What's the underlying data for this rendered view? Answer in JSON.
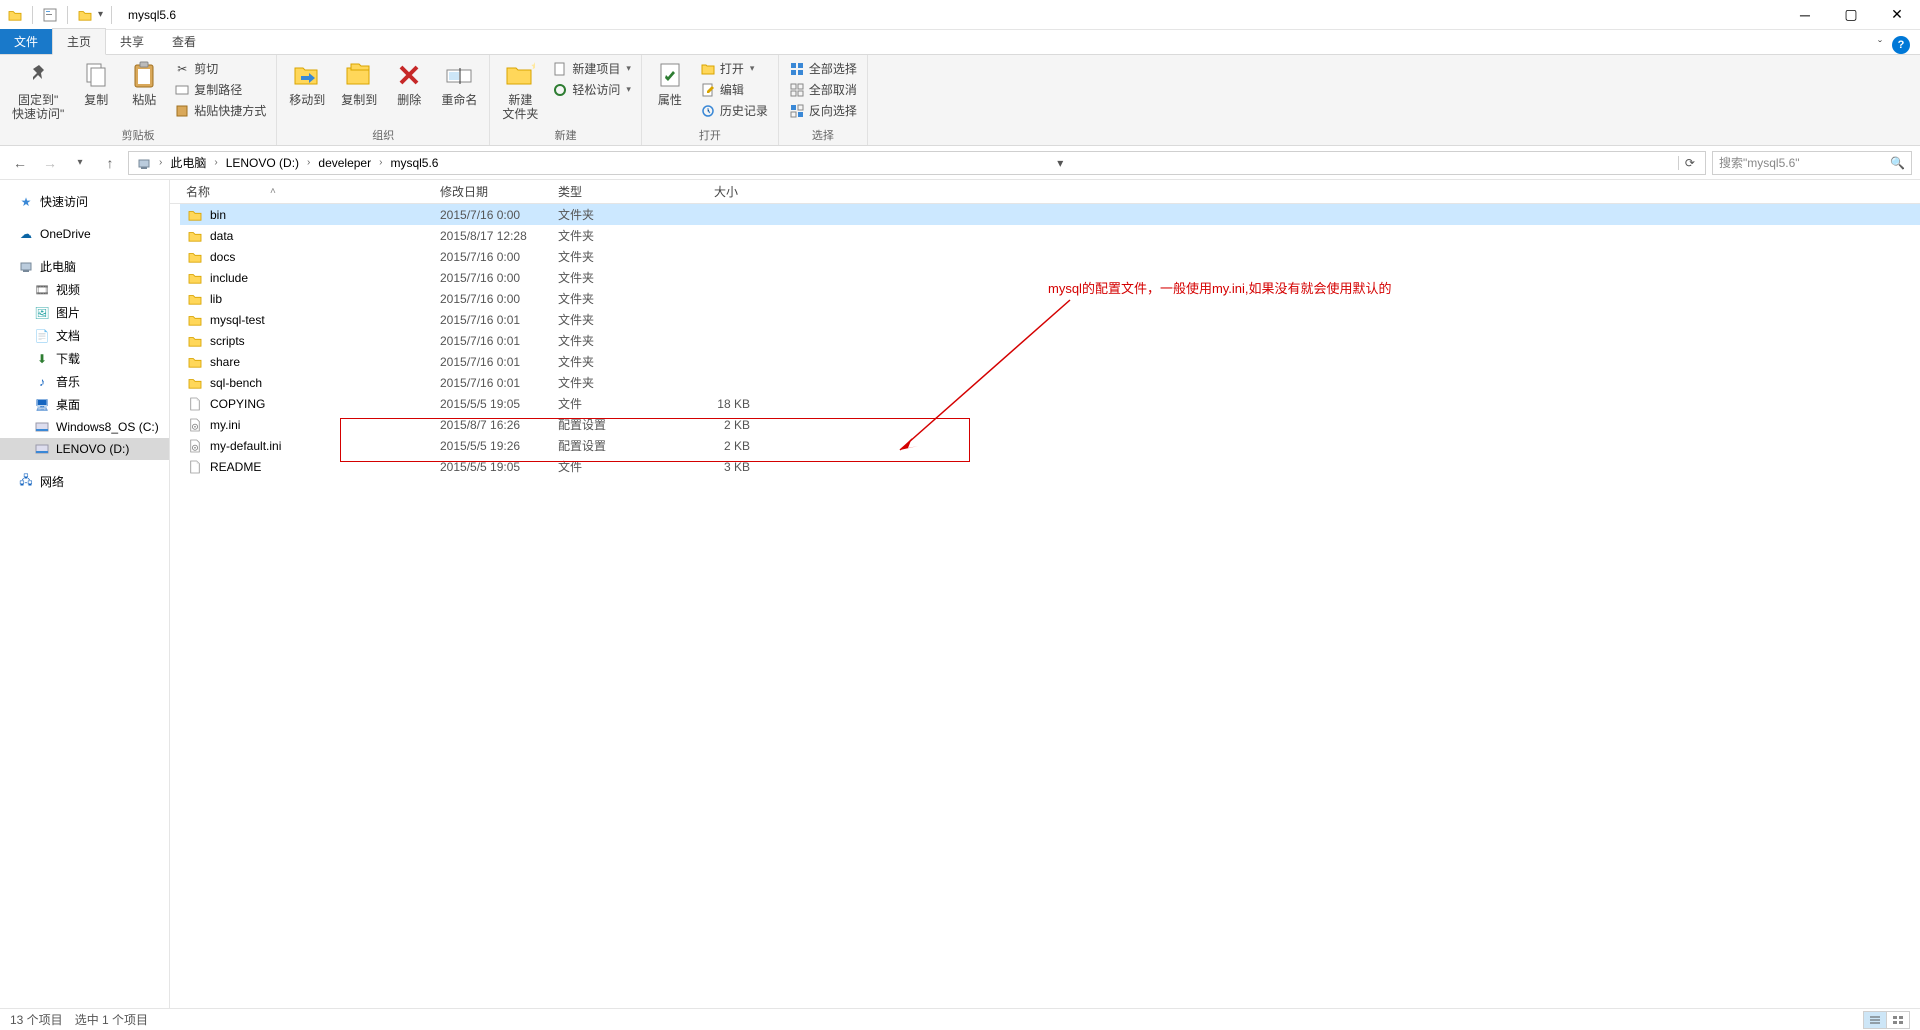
{
  "window": {
    "title": "mysql5.6"
  },
  "tabs": {
    "file": "文件",
    "home": "主页",
    "share": "共享",
    "view": "查看"
  },
  "ribbon": {
    "clipboard": {
      "label": "剪贴板",
      "pin": "固定到\"\n快速访问\"",
      "copy": "复制",
      "paste": "粘贴",
      "cut": "剪切",
      "copypath": "复制路径",
      "pasteshortcut": "粘贴快捷方式"
    },
    "organize": {
      "label": "组织",
      "moveto": "移动到",
      "copyto": "复制到",
      "delete": "删除",
      "rename": "重命名"
    },
    "new": {
      "label": "新建",
      "newfolder": "新建\n文件夹",
      "newitem": "新建项目",
      "easyaccess": "轻松访问"
    },
    "open": {
      "label": "打开",
      "properties": "属性",
      "open": "打开",
      "edit": "编辑",
      "history": "历史记录"
    },
    "select": {
      "label": "选择",
      "selectall": "全部选择",
      "selectnone": "全部取消",
      "invert": "反向选择"
    }
  },
  "breadcrumb": [
    "此电脑",
    "LENOVO (D:)",
    "develeper",
    "mysql5.6"
  ],
  "addr_dropdown_hint": "▾",
  "search": {
    "placeholder": "搜索\"mysql5.6\""
  },
  "sidebar": {
    "quickaccess": "快速访问",
    "onedrive": "OneDrive",
    "thispc": "此电脑",
    "videos": "视频",
    "pictures": "图片",
    "documents": "文档",
    "downloads": "下载",
    "music": "音乐",
    "desktop": "桌面",
    "win8": "Windows8_OS (C:)",
    "lenovo": "LENOVO (D:)",
    "network": "网络"
  },
  "columns": {
    "name": "名称",
    "date": "修改日期",
    "type": "类型",
    "size": "大小"
  },
  "files": [
    {
      "icon": "folder",
      "name": "bin",
      "date": "2015/7/16 0:00",
      "type": "文件夹",
      "size": "",
      "selected": true
    },
    {
      "icon": "folder",
      "name": "data",
      "date": "2015/8/17 12:28",
      "type": "文件夹",
      "size": ""
    },
    {
      "icon": "folder",
      "name": "docs",
      "date": "2015/7/16 0:00",
      "type": "文件夹",
      "size": ""
    },
    {
      "icon": "folder",
      "name": "include",
      "date": "2015/7/16 0:00",
      "type": "文件夹",
      "size": ""
    },
    {
      "icon": "folder",
      "name": "lib",
      "date": "2015/7/16 0:00",
      "type": "文件夹",
      "size": ""
    },
    {
      "icon": "folder",
      "name": "mysql-test",
      "date": "2015/7/16 0:01",
      "type": "文件夹",
      "size": ""
    },
    {
      "icon": "folder",
      "name": "scripts",
      "date": "2015/7/16 0:01",
      "type": "文件夹",
      "size": ""
    },
    {
      "icon": "folder",
      "name": "share",
      "date": "2015/7/16 0:01",
      "type": "文件夹",
      "size": ""
    },
    {
      "icon": "folder",
      "name": "sql-bench",
      "date": "2015/7/16 0:01",
      "type": "文件夹",
      "size": ""
    },
    {
      "icon": "file",
      "name": "COPYING",
      "date": "2015/5/5 19:05",
      "type": "文件",
      "size": "18 KB"
    },
    {
      "icon": "ini",
      "name": "my.ini",
      "date": "2015/8/7 16:26",
      "type": "配置设置",
      "size": "2 KB"
    },
    {
      "icon": "ini",
      "name": "my-default.ini",
      "date": "2015/5/5 19:26",
      "type": "配置设置",
      "size": "2 KB"
    },
    {
      "icon": "file",
      "name": "README",
      "date": "2015/5/5 19:05",
      "type": "文件",
      "size": "3 KB"
    }
  ],
  "annotation": "mysql的配置文件，一般使用my.ini,如果没有就会使用默认的",
  "status": {
    "count": "13 个项目",
    "selected": "选中 1 个项目"
  }
}
